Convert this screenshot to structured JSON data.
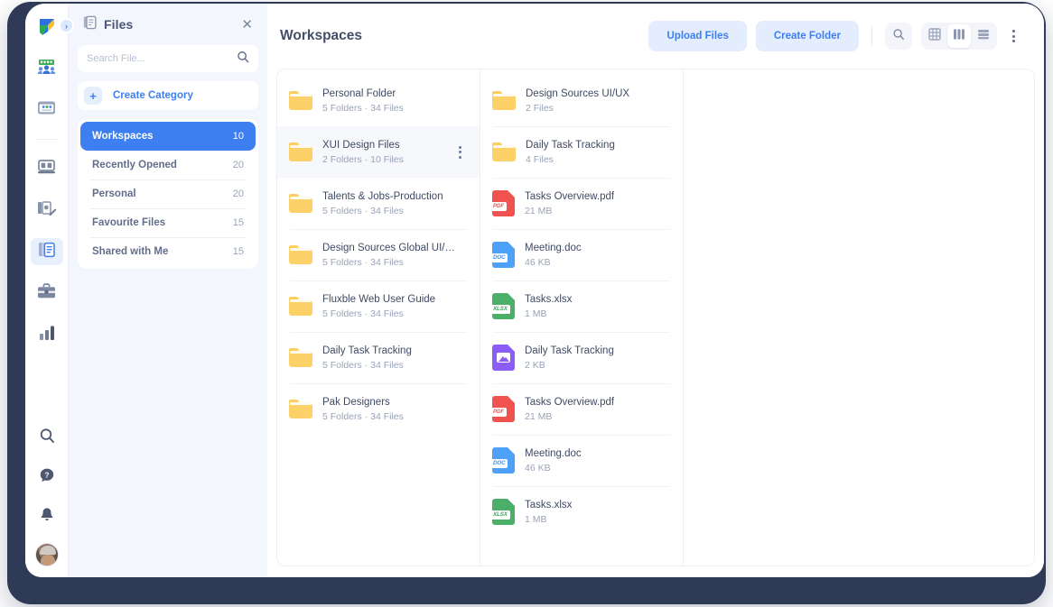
{
  "rail": {
    "logo_name": "app-logo",
    "expand_label": "›",
    "items": [
      {
        "name": "team-icon",
        "active": false
      },
      {
        "name": "card-icon",
        "active": false
      },
      {
        "name": "board-icon",
        "active": false
      },
      {
        "name": "notes-edit-icon",
        "active": false
      },
      {
        "name": "files-icon",
        "active": true
      },
      {
        "name": "briefcase-icon",
        "active": false
      },
      {
        "name": "analytics-icon",
        "active": false
      }
    ],
    "bottom": [
      {
        "name": "search-icon"
      },
      {
        "name": "help-icon"
      },
      {
        "name": "bell-icon"
      }
    ]
  },
  "files_panel": {
    "title": "Files",
    "close_label": "✕",
    "search": {
      "placeholder": "Search File...",
      "value": ""
    },
    "create_category": {
      "plus": "+",
      "label": "Create Category"
    },
    "categories": [
      {
        "label": "Workspaces",
        "count": "10",
        "active": true
      },
      {
        "label": "Recently Opened",
        "count": "20",
        "active": false
      },
      {
        "label": "Personal",
        "count": "20",
        "active": false
      },
      {
        "label": "Favourite Files",
        "count": "15",
        "active": false
      },
      {
        "label": "Shared with Me",
        "count": "15",
        "active": false
      }
    ]
  },
  "toolbar": {
    "page_title": "Workspaces",
    "upload_label": "Upload Files",
    "create_folder_label": "Create Folder",
    "search_icon": "search-icon",
    "views": [
      {
        "name": "grid-view-icon",
        "active": false
      },
      {
        "name": "column-view-icon",
        "active": true
      },
      {
        "name": "list-view-icon",
        "active": false
      }
    ],
    "more_label": "more-options"
  },
  "columns": [
    {
      "items": [
        {
          "kind": "folder",
          "title": "Personal Folder",
          "sub": "5 Folders  ·  34 Files",
          "selected": false,
          "menu": false
        },
        {
          "kind": "folder",
          "title": "XUI Design Files",
          "sub": "2 Folders  ·  10 Files",
          "selected": true,
          "menu": true
        },
        {
          "kind": "folder",
          "title": "Talents & Jobs-Production",
          "sub": "5 Folders  ·  34 Files",
          "selected": false,
          "menu": false
        },
        {
          "kind": "folder",
          "title": "Design Sources Global UI/UX",
          "sub": "5 Folders  ·  34 Files",
          "selected": false,
          "menu": false
        },
        {
          "kind": "folder",
          "title": "Fluxble Web User Guide",
          "sub": "5 Folders  ·  34 Files",
          "selected": false,
          "menu": false
        },
        {
          "kind": "folder",
          "title": "Daily Task Tracking",
          "sub": "5 Folders  ·  34 Files",
          "selected": false,
          "menu": false
        },
        {
          "kind": "folder",
          "title": "Pak Designers",
          "sub": "5 Folders  ·  34 Files",
          "selected": false,
          "menu": false
        }
      ]
    },
    {
      "items": [
        {
          "kind": "folder",
          "title": "Design Sources UI/UX",
          "sub": "2 Files",
          "selected": false,
          "menu": false
        },
        {
          "kind": "folder",
          "title": "Daily Task Tracking",
          "sub": "4 Files",
          "selected": false,
          "menu": false
        },
        {
          "kind": "file",
          "filetype": "pdf",
          "tag": "PDF",
          "color": "#f0534f",
          "tagcolor": "#f0534f",
          "title": "Tasks Overview.pdf",
          "sub": "21 MB",
          "selected": false,
          "menu": false
        },
        {
          "kind": "file",
          "filetype": "doc",
          "tag": "DOC",
          "color": "#4da1f7",
          "tagcolor": "#3d8ee8",
          "title": "Meeting.doc",
          "sub": "46 KB",
          "selected": false,
          "menu": false
        },
        {
          "kind": "file",
          "filetype": "xlsx",
          "tag": "XLSX",
          "color": "#4caf69",
          "tagcolor": "#3ea25c",
          "title": "Tasks.xlsx",
          "sub": "1 MB",
          "selected": false,
          "menu": false
        },
        {
          "kind": "file",
          "filetype": "image",
          "tag": "",
          "color": "#8b5cf6",
          "tagcolor": "#8b5cf6",
          "title": "Daily Task Tracking",
          "sub": "2 KB",
          "selected": false,
          "menu": false
        },
        {
          "kind": "file",
          "filetype": "pdf",
          "tag": "PDF",
          "color": "#f0534f",
          "tagcolor": "#f0534f",
          "title": "Tasks Overview.pdf",
          "sub": "21 MB",
          "selected": false,
          "menu": false
        },
        {
          "kind": "file",
          "filetype": "doc",
          "tag": "DOC",
          "color": "#4da1f7",
          "tagcolor": "#3d8ee8",
          "title": "Meeting.doc",
          "sub": "46 KB",
          "selected": false,
          "menu": false
        },
        {
          "kind": "file",
          "filetype": "xlsx",
          "tag": "XLSX",
          "color": "#4caf69",
          "tagcolor": "#3ea25c",
          "title": "Tasks.xlsx",
          "sub": "1 MB",
          "selected": false,
          "menu": false
        }
      ]
    }
  ],
  "colors": {
    "accent": "#3d7ff1",
    "accent_soft": "#e4edfd",
    "panel_bg": "#f3f6fd",
    "frame": "#2f3a56",
    "folder": "#fcd268",
    "pdf": "#f0534f",
    "doc": "#4da1f7",
    "xlsx": "#4caf69",
    "image": "#8b5cf6"
  }
}
